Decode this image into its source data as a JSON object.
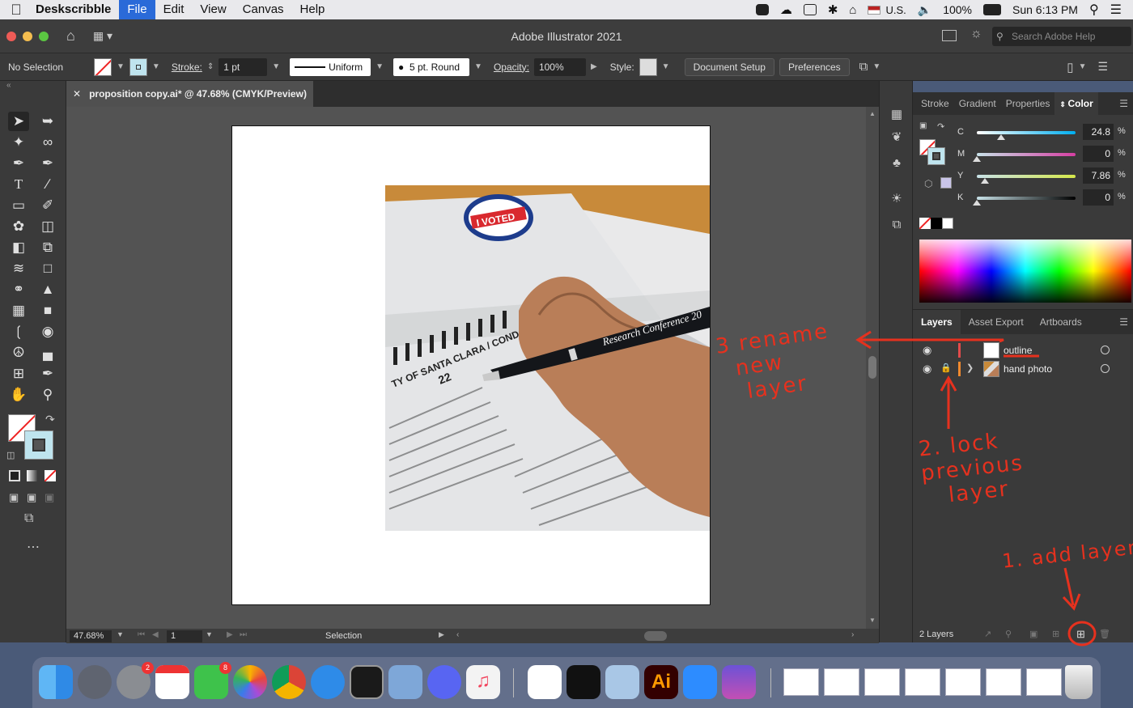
{
  "menubar": {
    "app_name": "Deskscribble",
    "items": [
      "File",
      "Edit",
      "View",
      "Canvas",
      "Help"
    ],
    "input_source": "U.S.",
    "battery": "100%",
    "clock": "Sun 6:13 PM"
  },
  "window": {
    "title": "Adobe Illustrator 2021",
    "search_placeholder": "Search Adobe Help"
  },
  "control_bar": {
    "selection": "No Selection",
    "stroke_label": "Stroke:",
    "stroke_weight": "1 pt",
    "profile": "Uniform",
    "brush": "5 pt. Round",
    "opacity_label": "Opacity:",
    "opacity": "100%",
    "style_label": "Style:",
    "document_setup": "Document Setup",
    "preferences": "Preferences"
  },
  "document": {
    "tab_title": "proposition copy.ai* @ 47.68% (CMYK/Preview)"
  },
  "status_bar": {
    "zoom": "47.68%",
    "artboard_number": "1",
    "tool_name": "Selection"
  },
  "color_panel": {
    "tabs": [
      "Stroke",
      "Gradient",
      "Properties",
      "Color"
    ],
    "active_tab": "Color",
    "channels": [
      {
        "label": "C",
        "value": "24.8",
        "fraction": 0.248,
        "track": "linear-gradient(to right,#ffffff,#00aeef)"
      },
      {
        "label": "M",
        "value": "0",
        "fraction": 0.0,
        "track": "linear-gradient(to right,#c8e2e8,#d63fa3)"
      },
      {
        "label": "Y",
        "value": "7.86",
        "fraction": 0.0786,
        "track": "linear-gradient(to right,#c8e2e8,#d6e84a)"
      },
      {
        "label": "K",
        "value": "0",
        "fraction": 0.0,
        "track": "linear-gradient(to right,#c8e2e8,#000000)"
      }
    ],
    "percent_sign": "%"
  },
  "layers_panel": {
    "tabs": [
      "Layers",
      "Asset Export",
      "Artboards"
    ],
    "active_tab": "Layers",
    "layers": [
      {
        "name": "outline",
        "color": "#e34b4b",
        "locked": false
      },
      {
        "name": "hand photo",
        "color": "#f0892e",
        "locked": true
      }
    ],
    "count_label": "2 Layers"
  },
  "photo_text": {
    "sticker": "I VOTED",
    "pen": "Research Conference 20",
    "ballot_heading": "TY OF SANTA CLARA / CONDADO DE SANT",
    "prop_number": "22"
  },
  "annotations": {
    "step3": "3 rename\n  new\n   layer",
    "step2": "2. lock\nprevious\n   layer",
    "step1": "1. add layer"
  },
  "colors": {
    "accent": "#2a6ad8",
    "annotation": "#e6311e",
    "panel_bg": "#3a3a3a",
    "canvas_bg": "#535353"
  }
}
